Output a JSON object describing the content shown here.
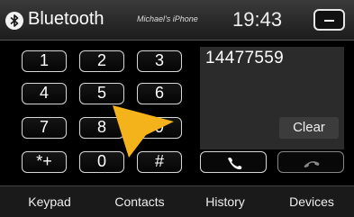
{
  "header": {
    "title": "Bluetooth",
    "device_name": "Michael's iPhone",
    "time": "19:43",
    "icon": "bluetooth-icon",
    "minimize_icon": "minimize-icon"
  },
  "keypad": {
    "keys": [
      "1",
      "2",
      "3",
      "4",
      "5",
      "6",
      "7",
      "8",
      "9",
      "*+",
      "0",
      "#"
    ]
  },
  "display": {
    "number": "14477559",
    "clear_label": "Clear"
  },
  "call_buttons": {
    "dial_icon": "phone-call-icon",
    "hangup_icon": "phone-hangup-icon"
  },
  "tabs": [
    "Keypad",
    "Contacts",
    "History",
    "Devices"
  ],
  "colors": {
    "pointer": "#f5b31b",
    "display_bg": "#2b2b2b",
    "background": "#000000"
  }
}
